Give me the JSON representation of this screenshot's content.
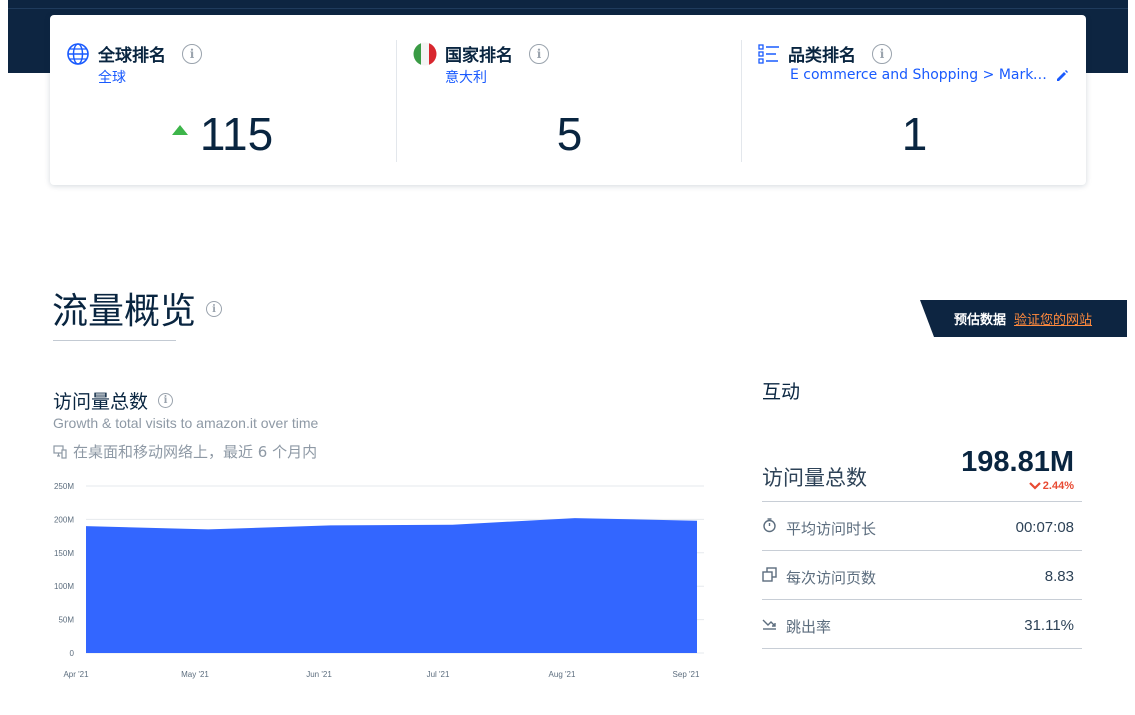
{
  "ranks": {
    "global": {
      "title": "全球排名",
      "sub": "全球",
      "value": "115",
      "trend": "up",
      "icon": "globe-icon"
    },
    "country": {
      "title": "国家排名",
      "sub": "意大利",
      "value": "5",
      "icon": "italy-flag-icon"
    },
    "category": {
      "title": "品类排名",
      "sub": "E commerce and Shopping > Marketplace",
      "value": "1",
      "icon": "category-list-icon"
    }
  },
  "overview": {
    "title": "流量概览",
    "banner_label": "预估数据",
    "banner_link": "验证您的网站"
  },
  "visits": {
    "title": "访问量总数",
    "desc": "Growth & total visits to amazon.it over time",
    "scope": "在桌面和移动网络上，最近 6 个月内"
  },
  "chart_data": {
    "type": "area",
    "x": [
      "Apr '21",
      "May '21",
      "Jun '21",
      "Jul '21",
      "Aug '21",
      "Sep '21"
    ],
    "series": [
      {
        "values": [
          190,
          185,
          191,
          192,
          202,
          198
        ]
      }
    ],
    "y_ticks": [
      "0",
      "50M",
      "100M",
      "150M",
      "200M",
      "250M"
    ],
    "ylim": [
      0,
      250
    ],
    "grid": true,
    "color": "#3366ff"
  },
  "engagement": {
    "title": "互动",
    "visits_label": "访问量总数",
    "visits_value": "198.81M",
    "visits_change": "2.44%",
    "change_color": "#e84a32",
    "metrics": [
      {
        "label": "平均访问时长",
        "value": "00:07:08",
        "icon": "clock-icon"
      },
      {
        "label": "每次访问页数",
        "value": "8.83",
        "icon": "pages-icon"
      },
      {
        "label": "跳出率",
        "value": "31.11%",
        "icon": "bounce-icon"
      }
    ]
  }
}
